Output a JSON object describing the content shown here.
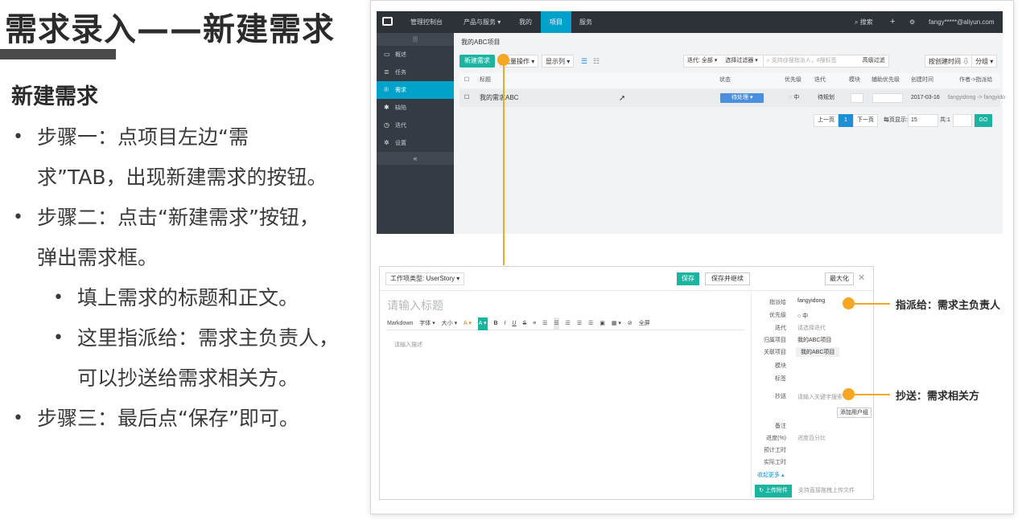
{
  "slide": {
    "title": "需求录入——新建需求",
    "section": "新建需求",
    "bullets": [
      "步骤一：点项目左边“需求”TAB，出现新建需求的按钮。",
      "步骤二：点击“新建需求”按钮，弹出需求框。",
      "步骤三：最后点“保存”即可。"
    ],
    "sub_bullets": [
      "填上需求的标题和正文。",
      "这里指派给：需求主负责人，可以抄送给需求相关方。"
    ]
  },
  "console": {
    "nav": [
      "管理控制台",
      "产品与服务 ▾",
      "我的",
      "项目",
      "服务"
    ],
    "nav_right": [
      "搜索",
      "+",
      "⚙",
      "fangy*****@aliyun.com"
    ],
    "sidebar": [
      "概述",
      "任务",
      "需求",
      "缺陷",
      "迭代",
      "设置"
    ],
    "project_name": "我的ABC项目",
    "toolbar": {
      "new_req": "新建需求",
      "batch": "批量操作 ▾",
      "columns": "显示列 ▾",
      "iteration": "迭代:",
      "iteration_val": "全部 ▾",
      "filter": "选择过滤器 ▾",
      "search_ph": "支持@搜指派人，#搜标签",
      "advanced": "高级过滤",
      "sort": "按创建时间 ⇩",
      "group": "分组 ▾"
    },
    "table_headers": [
      "标题",
      "状态",
      "优先级",
      "迭代",
      "模块",
      "辅助优先级",
      "创建时间",
      "作者->指派给"
    ],
    "row": {
      "title": "我的需求ABC",
      "status": "待处理 ▾",
      "priority": "中",
      "iteration": "待规划",
      "created": "2017-03-16",
      "assign": "fangyidong -> fangyido"
    },
    "pager": {
      "prev": "上一页",
      "page": "1",
      "next": "下一页",
      "per_page_label": "每页显示:",
      "per_page": "15",
      "total": "共:1",
      "go": "GO"
    }
  },
  "dialog": {
    "work_type": "工作项类型:  UserStory ▾",
    "save": "保存",
    "save_continue": "保存并继续",
    "maximize": "最大化",
    "title_placeholder": "请输入标题",
    "toolbar": [
      "Markdown",
      "字体 ▾",
      "大小 ▾",
      "A ▾",
      "A ▾",
      "B",
      "I",
      "U",
      "S",
      "≡",
      "☰",
      "☰",
      "☰",
      "☰",
      "☰",
      "▣",
      "▦ ▾",
      "⊘",
      "全屏"
    ],
    "desc_placeholder": "请输入描述",
    "props": [
      {
        "label": "指派给",
        "value": "fangyidong"
      },
      {
        "label": "优先级",
        "value": "○ 中"
      },
      {
        "label": "迭代",
        "value": "请选择迭代"
      },
      {
        "label": "归属项目",
        "value": "我的ABC项目"
      },
      {
        "label": "关联项目",
        "value": "我的ABC项目"
      },
      {
        "label": "模块",
        "value": ""
      },
      {
        "label": "标签",
        "value": ""
      },
      {
        "label": "抄送",
        "value": "请输入关键字搜索"
      },
      {
        "label": "备注",
        "value": ""
      },
      {
        "label": "进度(%)",
        "value": "进度百分比"
      },
      {
        "label": "预计工时",
        "value": ""
      },
      {
        "label": "实际工时",
        "value": ""
      }
    ],
    "add_group": "添加用户组",
    "more": "收起更多 ▴",
    "upload": "↻ 上传附件",
    "upload_hint": "支持直接拖拽上传文件"
  },
  "callouts": {
    "assign": "指派给：需求主负责人",
    "cc": "抄送：需求相关方"
  },
  "colors": {
    "accent_orange": "#f5a623",
    "teal": "#1bb4a0",
    "nav_blue": "#00a2ca",
    "dark_nav": "#2d3238"
  }
}
